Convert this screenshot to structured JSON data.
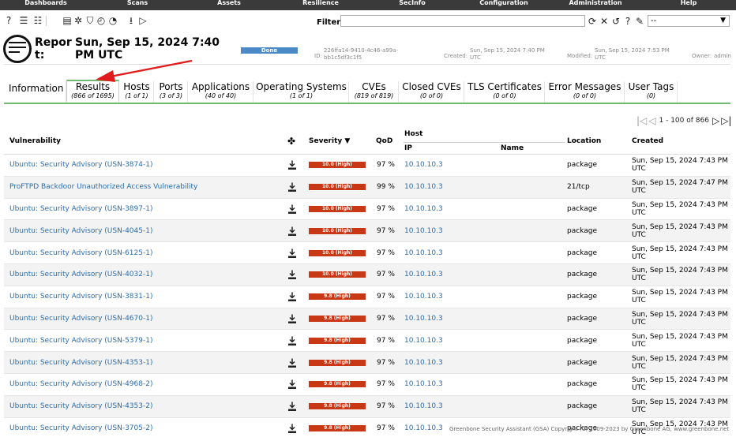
{
  "menu": [
    "Dashboards",
    "Scans",
    "Assets",
    "Resilience",
    "SecInfo",
    "Configuration",
    "Administration",
    "Help"
  ],
  "toolbar_icons": [
    "help-icon",
    "list-icon",
    "list-indent-icon",
    "report-icon",
    "bug-icon",
    "shield-icon",
    "speed-icon",
    "download-icon",
    "play-icon"
  ],
  "filter": {
    "label": "Filter",
    "value": "",
    "select_value": "--"
  },
  "filter_icons": [
    "refresh-icon",
    "clear-icon",
    "reset-icon",
    "help-icon",
    "edit-icon"
  ],
  "report": {
    "title": "Report:",
    "date": "Sun, Sep 15, 2024 7:40 PM UTC",
    "status": "Done",
    "id_label": "ID:",
    "id": "226ffa14-9410-4c46-a99a-bb1c5df3c1f5",
    "created_label": "Created:",
    "created": "Sun, Sep 15, 2024 7:40 PM UTC",
    "modified_label": "Modified:",
    "modified": "Sun, Sep 15, 2024 7:53 PM UTC",
    "owner_label": "Owner:",
    "owner": "admin"
  },
  "tabs": [
    {
      "label": "Information",
      "count": ""
    },
    {
      "label": "Results",
      "count": "(866 of 1695)"
    },
    {
      "label": "Hosts",
      "count": "(1 of 1)"
    },
    {
      "label": "Ports",
      "count": "(3 of 3)"
    },
    {
      "label": "Applications",
      "count": "(40 of 40)"
    },
    {
      "label": "Operating Systems",
      "count": "(1 of 1)"
    },
    {
      "label": "CVEs",
      "count": "(819 of 819)"
    },
    {
      "label": "Closed CVEs",
      "count": "(0 of 0)"
    },
    {
      "label": "TLS Certificates",
      "count": "(0 of 0)"
    },
    {
      "label": "Error Messages",
      "count": "(0 of 0)"
    },
    {
      "label": "User Tags",
      "count": "(0)"
    }
  ],
  "pager": {
    "text": "1 - 100 of 866"
  },
  "columns": {
    "vulnerability": "Vulnerability",
    "severity": "Severity ▼",
    "qod": "QoD",
    "host": "Host",
    "ip": "IP",
    "name": "Name",
    "location": "Location",
    "created": "Created"
  },
  "rows": [
    {
      "vuln": "Ubuntu: Security Advisory (USN-3874-1)",
      "severity": "10.0 (High)",
      "qod": "97 %",
      "ip": "10.10.10.3",
      "location": "package",
      "created": "Sun, Sep 15, 2024 7:43 PM UTC"
    },
    {
      "vuln": "ProFTPD Backdoor Unauthorized Access Vulnerability",
      "severity": "10.0 (High)",
      "qod": "99 %",
      "ip": "10.10.10.3",
      "location": "21/tcp",
      "created": "Sun, Sep 15, 2024 7:47 PM UTC"
    },
    {
      "vuln": "Ubuntu: Security Advisory (USN-3897-1)",
      "severity": "10.0 (High)",
      "qod": "97 %",
      "ip": "10.10.10.3",
      "location": "package",
      "created": "Sun, Sep 15, 2024 7:43 PM UTC"
    },
    {
      "vuln": "Ubuntu: Security Advisory (USN-4045-1)",
      "severity": "10.0 (High)",
      "qod": "97 %",
      "ip": "10.10.10.3",
      "location": "package",
      "created": "Sun, Sep 15, 2024 7:43 PM UTC"
    },
    {
      "vuln": "Ubuntu: Security Advisory (USN-6125-1)",
      "severity": "10.0 (High)",
      "qod": "97 %",
      "ip": "10.10.10.3",
      "location": "package",
      "created": "Sun, Sep 15, 2024 7:43 PM UTC"
    },
    {
      "vuln": "Ubuntu: Security Advisory (USN-4032-1)",
      "severity": "10.0 (High)",
      "qod": "97 %",
      "ip": "10.10.10.3",
      "location": "package",
      "created": "Sun, Sep 15, 2024 7:43 PM UTC"
    },
    {
      "vuln": "Ubuntu: Security Advisory (USN-3831-1)",
      "severity": "9.8 (High)",
      "qod": "97 %",
      "ip": "10.10.10.3",
      "location": "package",
      "created": "Sun, Sep 15, 2024 7:43 PM UTC"
    },
    {
      "vuln": "Ubuntu: Security Advisory (USN-4670-1)",
      "severity": "9.8 (High)",
      "qod": "97 %",
      "ip": "10.10.10.3",
      "location": "package",
      "created": "Sun, Sep 15, 2024 7:43 PM UTC"
    },
    {
      "vuln": "Ubuntu: Security Advisory (USN-5379-1)",
      "severity": "9.8 (High)",
      "qod": "97 %",
      "ip": "10.10.10.3",
      "location": "package",
      "created": "Sun, Sep 15, 2024 7:43 PM UTC"
    },
    {
      "vuln": "Ubuntu: Security Advisory (USN-4353-1)",
      "severity": "9.8 (High)",
      "qod": "97 %",
      "ip": "10.10.10.3",
      "location": "package",
      "created": "Sun, Sep 15, 2024 7:43 PM UTC"
    },
    {
      "vuln": "Ubuntu: Security Advisory (USN-4968-2)",
      "severity": "9.8 (High)",
      "qod": "97 %",
      "ip": "10.10.10.3",
      "location": "package",
      "created": "Sun, Sep 15, 2024 7:43 PM UTC"
    },
    {
      "vuln": "Ubuntu: Security Advisory (USN-4353-2)",
      "severity": "9.8 (High)",
      "qod": "97 %",
      "ip": "10.10.10.3",
      "location": "package",
      "created": "Sun, Sep 15, 2024 7:43 PM UTC"
    },
    {
      "vuln": "Ubuntu: Security Advisory (USN-3705-2)",
      "severity": "9.8 (High)",
      "qod": "97 %",
      "ip": "10.10.10.3",
      "location": "package",
      "created": "Sun, Sep 15, 2024 7:43 PM UTC"
    }
  ],
  "footer": "Greenbone Security Assistant (GSA) Copyright (C) 2009-2023 by Greenbone AG, www.greenbone.net",
  "colors": {
    "menu_bg": "#3a3a3a",
    "severity_high": "#c83814",
    "done": "#4c8ac7",
    "tab_accent": "#6fba6f",
    "link": "#2a6db0",
    "annotation_arrow": "#e01b1b"
  }
}
